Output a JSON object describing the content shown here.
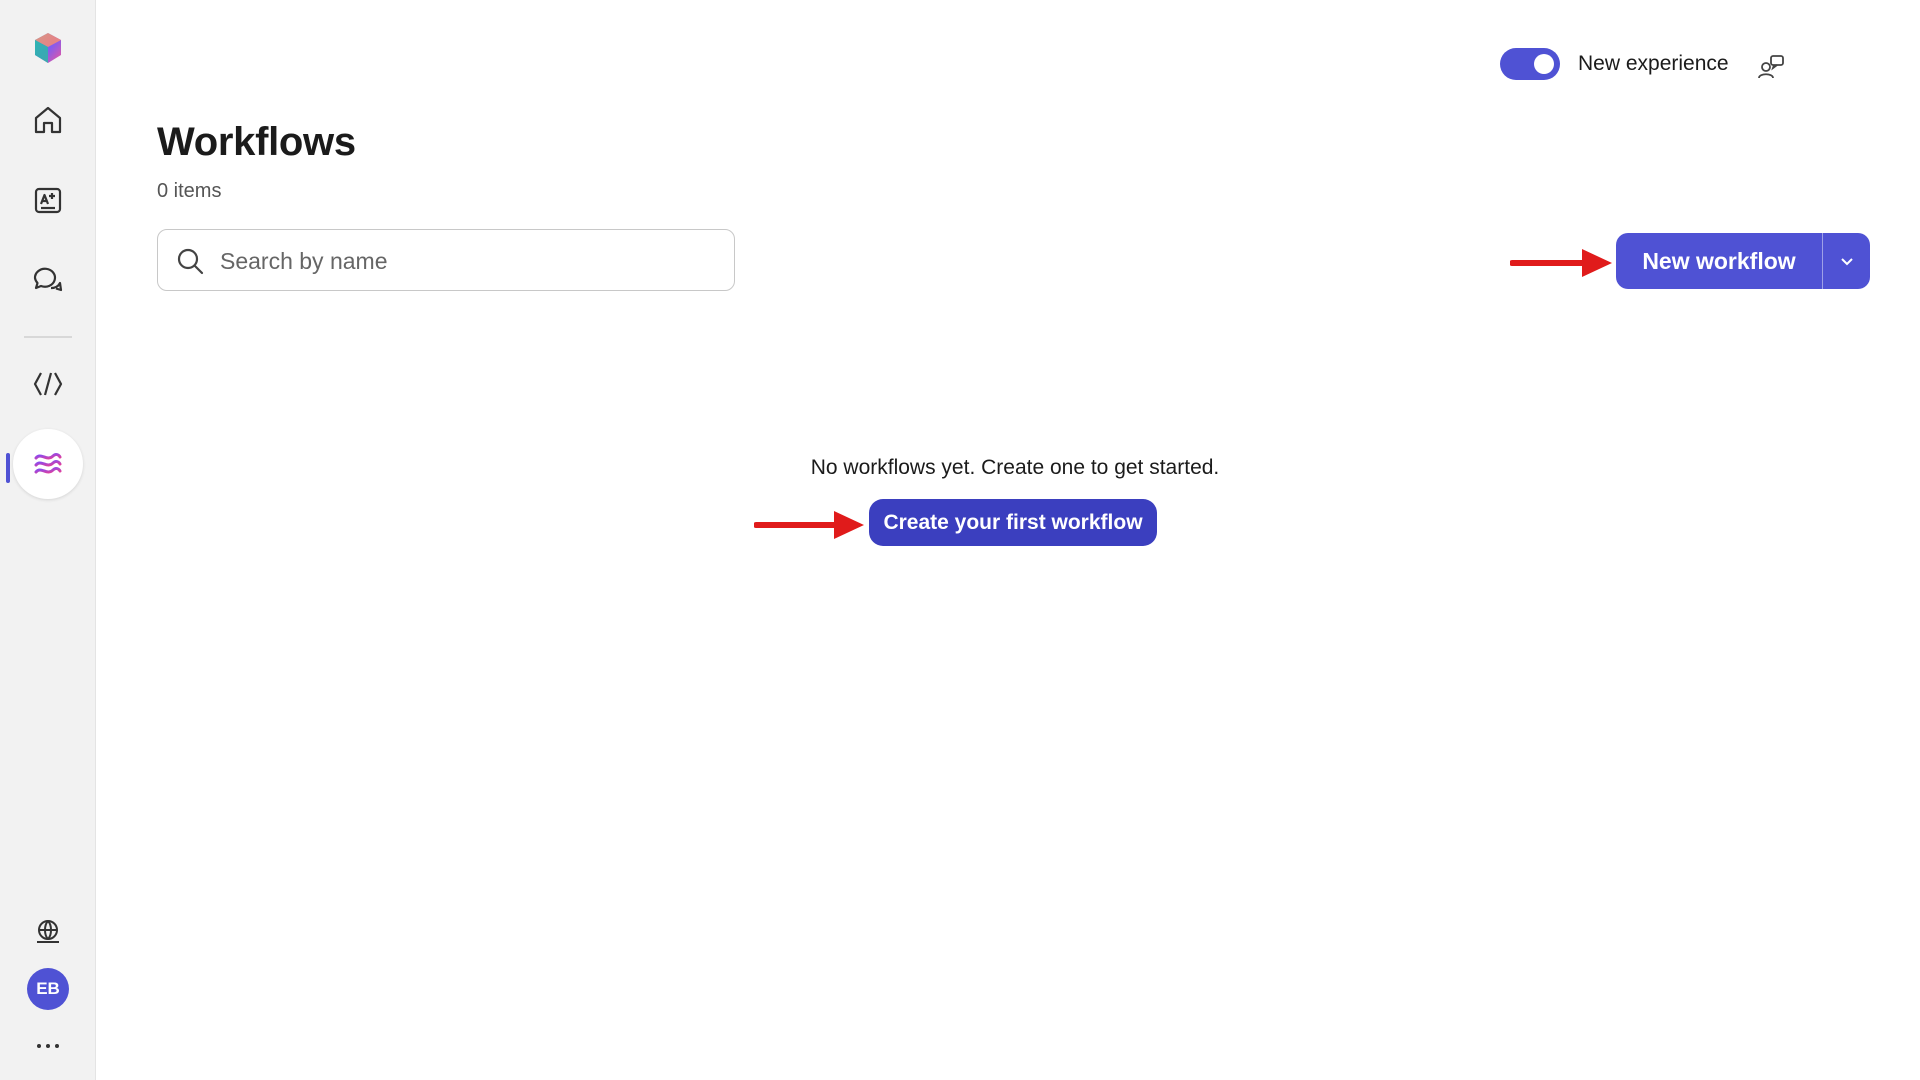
{
  "sidebar": {
    "items": [
      {
        "name": "app-logo"
      },
      {
        "name": "home"
      },
      {
        "name": "create"
      },
      {
        "name": "chat"
      },
      {
        "name": "agents"
      },
      {
        "name": "workflows"
      }
    ],
    "avatar_initials": "EB"
  },
  "header": {
    "toggle_label": "New experience",
    "toggle_on": true
  },
  "main": {
    "title": "Workflows",
    "item_count": "0 items",
    "search_placeholder": "Search by name",
    "new_workflow_label": "New workflow",
    "empty_message": "No workflows yet. Create one to get started.",
    "create_first_label": "Create your first workflow"
  },
  "colors": {
    "accent": "#4f52d4",
    "annotation_arrow": "#e01b1b",
    "rail_background": "#f2f2f2"
  }
}
